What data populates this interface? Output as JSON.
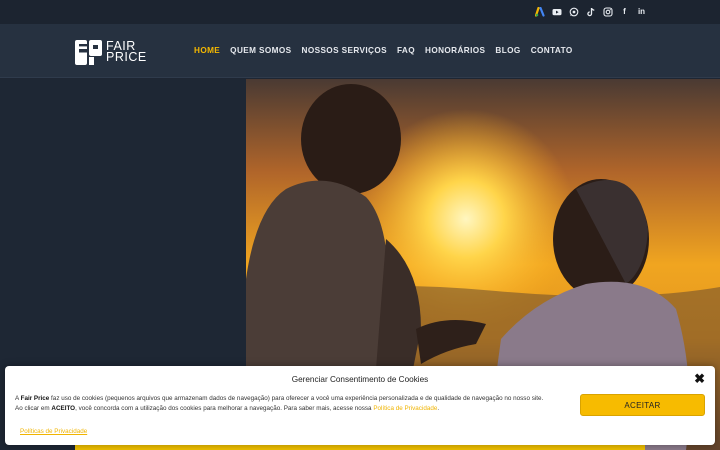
{
  "social": {
    "icons": [
      "google-ads-icon",
      "youtube-icon",
      "whatsapp-icon",
      "tiktok-icon",
      "instagram-icon",
      "facebook-icon",
      "linkedin-icon"
    ],
    "facebook_glyph": "f",
    "linkedin_glyph": "in"
  },
  "brand": {
    "line1": "FAIR",
    "line2": "PRICE"
  },
  "nav": {
    "items": [
      "HOME",
      "QUEM SOMOS",
      "NOSSOS SERVIÇOS",
      "FAQ",
      "HONORÁRIOS",
      "BLOG",
      "CONTATO"
    ],
    "active": "HOME",
    "active_color": "#f5b800"
  },
  "cookie": {
    "title": "Gerenciar Consentimento de Cookies",
    "close": "✖",
    "text_a": "A ",
    "brand_bold": "Fair Price",
    "text_b": " faz uso de cookies (pequenos arquivos que armazenam dados de navegação) para oferecer a você uma experiência personalizada e de qualidade de navegação no nosso site.",
    "text_c": "Ao clicar em ",
    "accept_bold": "ACEITO",
    "text_d": ", você concorda com a utilização dos cookies para melhorar a navegação. Para saber mais, acesse nossa ",
    "policy_link": "Política de Privacidade",
    "text_e": ".",
    "accept_label": "ACEITAR",
    "policies_link": "Políticas de Privacidade",
    "accent": "#f7bb00"
  }
}
